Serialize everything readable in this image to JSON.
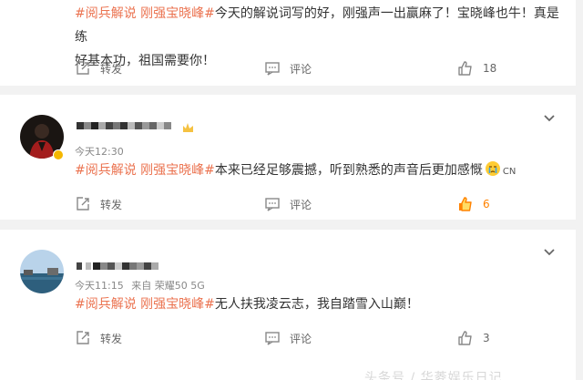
{
  "comments": [
    {
      "tags": "#阅兵解说 刚强宝晓峰#",
      "text": "今天的解说词写的好，刚强声一出赢麻了！宝晓峰也牛！真是练",
      "text_line2": "好基本功，祖国需要你！",
      "repost_label": "转发",
      "comment_label": "评论",
      "like_count": "18"
    },
    {
      "timestamp": "今天12:30",
      "tags": "#阅兵解说 刚强宝晓峰#",
      "text": "本来已经足够震撼，听到熟悉的声音后更加感慨",
      "emoji_name": "crying-emoji",
      "region": "CN",
      "repost_label": "转发",
      "comment_label": "评论",
      "like_count": "6"
    },
    {
      "timestamp": "今天11:15",
      "source": "来自 荣耀50 5G",
      "tags": "#阅兵解说 刚强宝晓峰#",
      "text": "无人扶我凌云志，我自踏雪入山巅！",
      "repost_label": "转发",
      "comment_label": "评论",
      "like_count": "3"
    }
  ],
  "watermark": "头条号 / 华菱娱乐日记",
  "colors": {
    "tag": "#eb7350",
    "liked": "#ff8200",
    "icon": "#888888",
    "badge": "#f5b700"
  },
  "icons": [
    "repost-icon",
    "comment-icon",
    "like-icon",
    "chevron-down-icon",
    "fan-badge-icon"
  ]
}
